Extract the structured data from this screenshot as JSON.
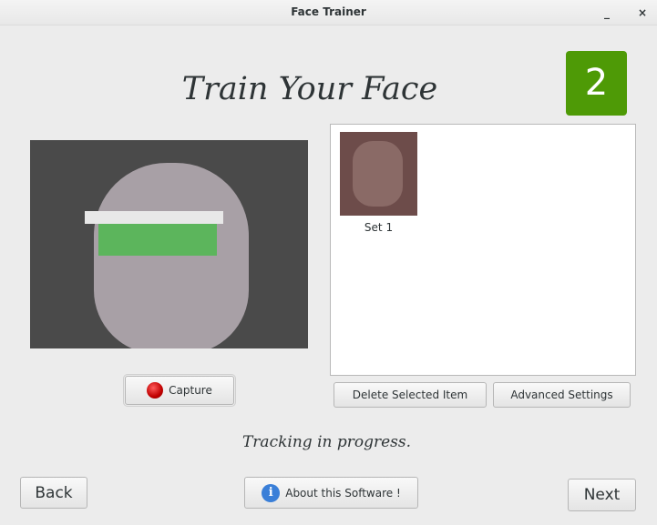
{
  "window": {
    "title": "Face Trainer",
    "minimize_glyph": "_",
    "close_glyph": "×"
  },
  "heading": "Train Your Face",
  "step": "2",
  "camera": {
    "icon": "camera-feed"
  },
  "gallery": {
    "items": [
      {
        "label": "Set 1"
      }
    ]
  },
  "buttons": {
    "capture": "Capture",
    "delete_selected": "Delete Selected Item",
    "advanced_settings": "Advanced Settings",
    "back": "Back",
    "about": "About this Software !",
    "next": "Next"
  },
  "icons": {
    "capture": "record-icon",
    "about": "info-icon",
    "info_glyph": "i"
  },
  "status": "Tracking in progress.",
  "colors": {
    "step_badge": "#4e9a06",
    "record": "#c00000",
    "info": "#3a7fd8"
  }
}
